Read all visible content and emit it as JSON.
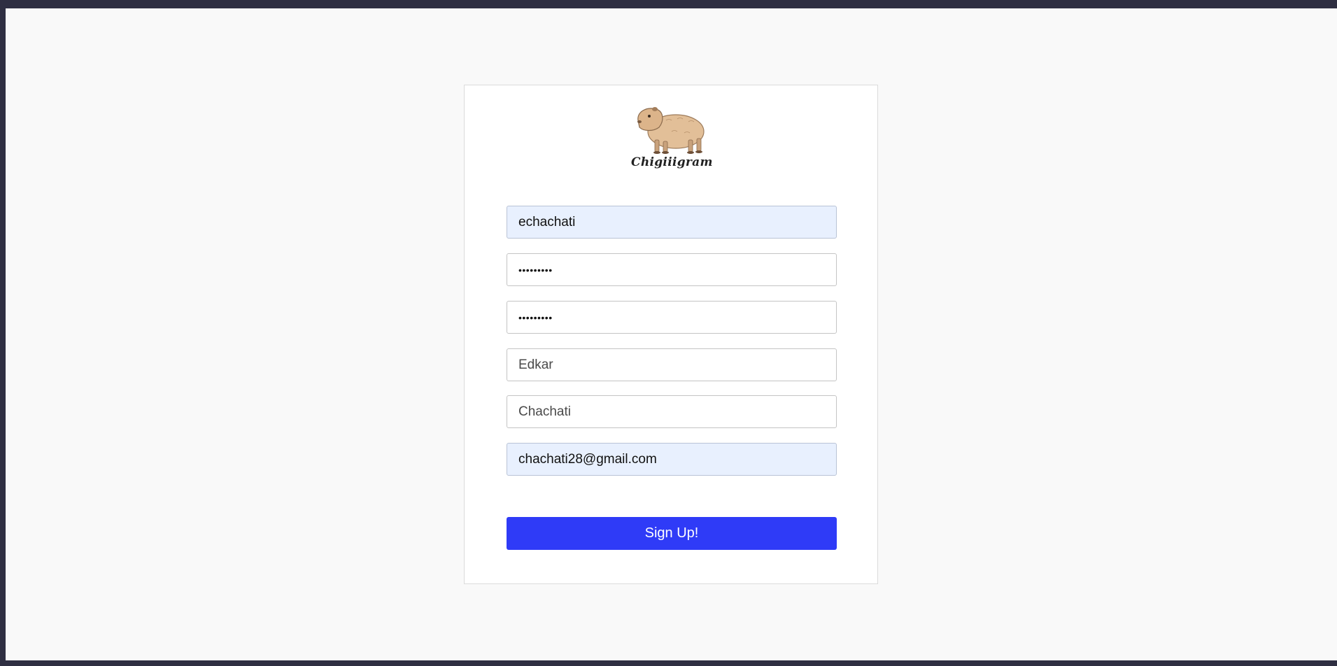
{
  "brand": {
    "logo_text": "Chigiiigram",
    "logo_icon": "capybara-logo-icon"
  },
  "form": {
    "username": {
      "value": "echachati",
      "placeholder": ""
    },
    "password": {
      "value": "echachati"
    },
    "confirm_password": {
      "value": "echachati"
    },
    "first_name": {
      "value": "",
      "placeholder": "Edkar"
    },
    "last_name": {
      "value": "",
      "placeholder": "Chachati"
    },
    "email": {
      "value": "chachati28@gmail.com",
      "placeholder": ""
    },
    "submit_label": "Sign Up!"
  },
  "colors": {
    "accent": "#2f3bf7",
    "autofill": "#e8f0fe",
    "page_bg": "#f9f9f9",
    "frame": "#2f2f42"
  }
}
